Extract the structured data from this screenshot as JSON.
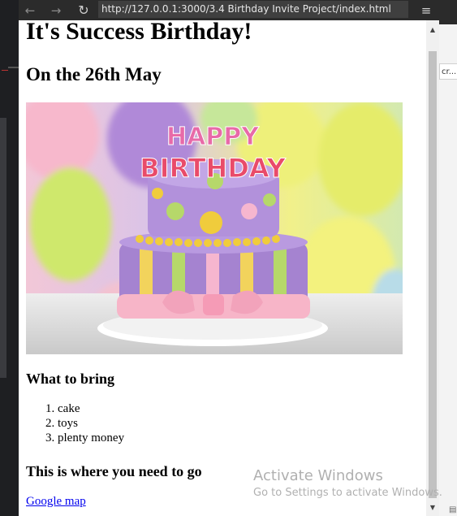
{
  "browser": {
    "url": "http://127.0.0.1:3000/3.4 Birthday Invite Project/index.html",
    "icons": {
      "back": "arrow-left-icon",
      "forward": "arrow-right-icon",
      "reload": "reload-icon",
      "menu": "hamburger-menu-icon"
    }
  },
  "page": {
    "title": "It's Success Birthday!",
    "subtitle": "On the 26th May",
    "image": {
      "cake_text": "HAPPY BIRTHDAY"
    },
    "bring_heading": "What to bring",
    "bring_items": [
      "cake",
      "toys",
      "plenty money"
    ],
    "go_heading": "This is where you need to go",
    "map_link": "Google map"
  },
  "side_panel": {
    "peek_text": "cr..."
  },
  "watermark": {
    "title": "Activate Windows",
    "subtitle": "Go to Settings to activate Windows."
  }
}
